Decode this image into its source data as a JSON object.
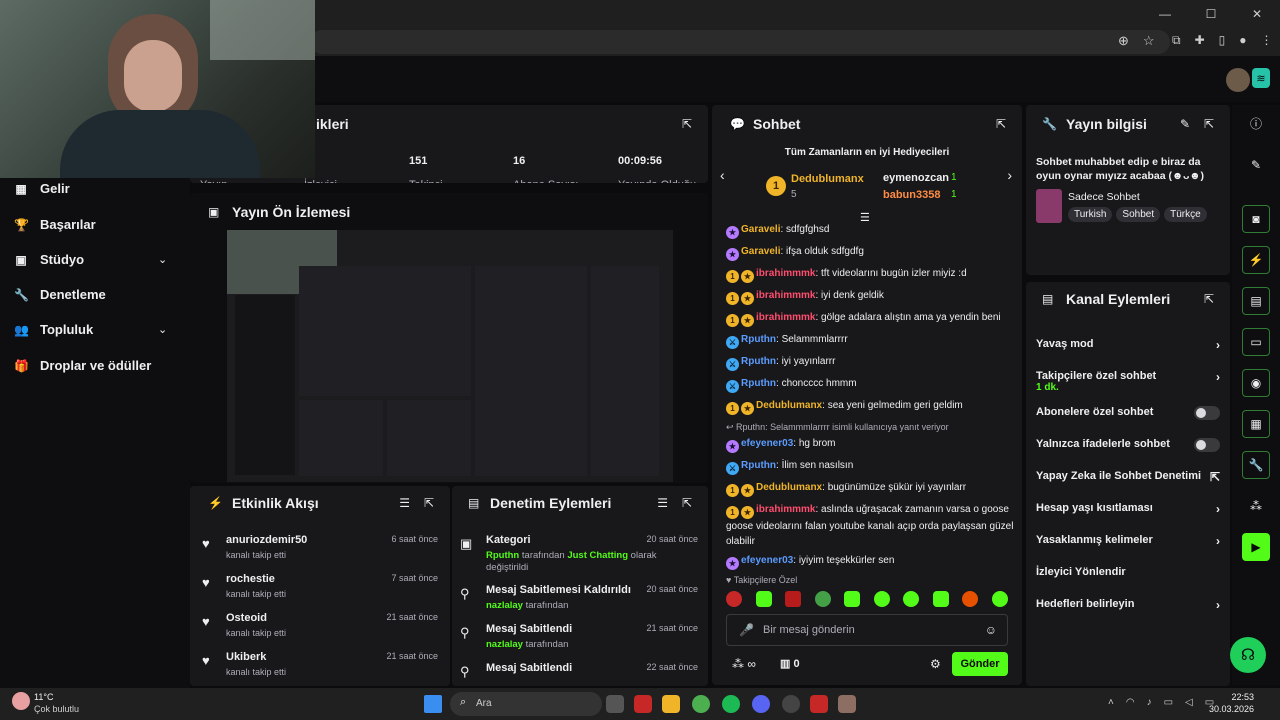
{
  "window": {
    "minimize": "—",
    "maximize": "☐",
    "close": "✕"
  },
  "sidebar": {
    "items": [
      {
        "label": "Gelir",
        "icon": "bar-chart-icon",
        "glyph": "▦",
        "chevron": false
      },
      {
        "label": "Başarılar",
        "icon": "trophy-icon",
        "glyph": "🏆",
        "chevron": false
      },
      {
        "label": "Stüdyo",
        "icon": "studio-icon",
        "glyph": "▣",
        "chevron": true
      },
      {
        "label": "Denetleme",
        "icon": "wrench-icon",
        "glyph": "🔧",
        "chevron": false
      },
      {
        "label": "Topluluk",
        "icon": "community-icon",
        "glyph": "👥",
        "chevron": true
      },
      {
        "label": "Droplar ve ödüller",
        "icon": "gift-icon",
        "glyph": "🎁",
        "chevron": false
      }
    ]
  },
  "stats": {
    "title_fragment": "ikleri",
    "items": [
      {
        "value": "",
        "label": "Yayın"
      },
      {
        "value": "",
        "label": "İzleyici"
      },
      {
        "value": "151",
        "label": "Takipçi"
      },
      {
        "value": "16",
        "label": "Abone Sayısı"
      },
      {
        "value": "00:09:56",
        "label": "Yayında Olduğu"
      }
    ]
  },
  "preview": {
    "title": "Yayın Ön İzlemesi"
  },
  "activity": {
    "title": "Etkinlik Akışı",
    "items": [
      {
        "name": "anuriozdemir50",
        "action": "kanalı takip etti",
        "time": "6 saat önce"
      },
      {
        "name": "rochestie",
        "action": "kanalı takip etti",
        "time": "7 saat önce"
      },
      {
        "name": "Osteoid",
        "action": "kanalı takip etti",
        "time": "21 saat önce"
      },
      {
        "name": "Ukiberk",
        "action": "kanalı takip etti",
        "time": "21 saat önce"
      }
    ]
  },
  "moderation": {
    "title": "Denetim Eylemleri",
    "items": [
      {
        "title": "Kategori",
        "user": "Rputhn",
        "mid": "tarafından",
        "target": "Just Chatting",
        "rest": "olarak değiştirildi",
        "time": "20 saat önce"
      },
      {
        "title": "Mesaj Sabitlemesi Kaldırıldı",
        "user": "nazlalay",
        "mid": "tarafından",
        "target": "",
        "rest": "",
        "time": "20 saat önce"
      },
      {
        "title": "Mesaj Sabitlendi",
        "user": "nazlalay",
        "mid": "tarafından",
        "target": "",
        "rest": "",
        "time": "21 saat önce"
      },
      {
        "title": "Mesaj Sabitlendi",
        "user": "",
        "mid": "",
        "target": "",
        "rest": "",
        "time": "22 saat önce"
      }
    ]
  },
  "chat": {
    "title": "Sohbet",
    "gifters_title": "Tüm Zamanların en iyi Hediyecileri",
    "top_gifter": {
      "name": "Dedublumanx",
      "count": "5",
      "rank": "1"
    },
    "gifters": [
      {
        "name": "eymenozcan",
        "count": "1"
      },
      {
        "name": "babun3358",
        "count": "1"
      }
    ],
    "messages": [
      {
        "badge": "sub",
        "user": "Garaveli",
        "color": "#f0b429",
        "text": "sdfgfghsd"
      },
      {
        "badge": "sub",
        "user": "Garaveli",
        "color": "#f0b429",
        "text": "ifşa olduk sdfgdfg"
      },
      {
        "badge": "gold",
        "user": "ibrahimmmk",
        "color": "#ff4d6d",
        "text": "tft videolarını bugün izler miyiz :d"
      },
      {
        "badge": "gold",
        "user": "ibrahimmmk",
        "color": "#ff4d6d",
        "text": "iyi denk geldik"
      },
      {
        "badge": "gold",
        "user": "ibrahimmmk",
        "color": "#ff4d6d",
        "text": "gölge adalara alıştın ama ya yendin beni"
      },
      {
        "badge": "blue",
        "user": "Rputhn",
        "color": "#5b9cff",
        "text": "Selammmlarrrr"
      },
      {
        "badge": "blue",
        "user": "Rputhn",
        "color": "#5b9cff",
        "text": "iyi yayınlarrr"
      },
      {
        "badge": "blue",
        "user": "Rputhn",
        "color": "#5b9cff",
        "text": "choncccc hmmm"
      },
      {
        "badge": "gold",
        "user": "Dedublumanx",
        "color": "#f0b429",
        "text": "sea yeni gelmedim geri geldim"
      },
      {
        "badge": "reply",
        "user": "",
        "color": "#adadb8",
        "text": "Rputhn: Selammmlarrrr isimli kullanıcıya yanıt veriyor"
      },
      {
        "badge": "sub",
        "user": "efeyener03",
        "color": "#5b9cff",
        "text": "hg brom"
      },
      {
        "badge": "blue",
        "user": "Rputhn",
        "color": "#5b9cff",
        "text": "İlim sen nasılsın"
      },
      {
        "badge": "gold",
        "user": "Dedublumanx",
        "color": "#f0b429",
        "text": "bugünümüze şükür iyi yayınlarr"
      },
      {
        "badge": "gold",
        "user": "ibrahimmmk",
        "color": "#ff4d6d",
        "text": "aslında uğraşacak zamanın varsa o goose goose videolarını falan youtube kanalı açıp orda paylaşsan güzel olabilir"
      },
      {
        "badge": "sub",
        "user": "efeyener03",
        "color": "#5b9cff",
        "text": "iyiyim teşekkürler sen"
      }
    ],
    "followers_only": "Takipçilere Özel",
    "input_placeholder": "Bir mesaj gönderin",
    "infinity": "∞",
    "count": "0",
    "send": "Gönder"
  },
  "info": {
    "title": "Yayın bilgisi",
    "stream_title": "Sohbet muhabbet edip e biraz da oyun oynar mıyızz acabaa (☻ᴗ☻)",
    "category": "Sadece Sohbet",
    "tags": [
      "Turkish",
      "Sohbet",
      "Türkçe"
    ]
  },
  "channel_actions": {
    "title": "Kanal Eylemleri",
    "items": [
      {
        "label": "Yavaş mod",
        "sub": "",
        "control": "chevron"
      },
      {
        "label": "Takipçilere özel sohbet",
        "sub": "1 dk.",
        "control": "chevron"
      },
      {
        "label": "Abonelere özel sohbet",
        "sub": "",
        "control": "toggle"
      },
      {
        "label": "Yalnızca ifadelerle sohbet",
        "sub": "",
        "control": "toggle"
      },
      {
        "label": "Yapay Zeka ile Sohbet Denetimi",
        "sub": "",
        "control": "external"
      },
      {
        "label": "Hesap yaşı kısıtlaması",
        "sub": "",
        "control": "chevron"
      },
      {
        "label": "Yasaklanmış kelimeler",
        "sub": "",
        "control": "chevron"
      },
      {
        "label": "İzleyici Yönlendir",
        "sub": "",
        "control": "none"
      },
      {
        "label": "Hedefleri belirleyin",
        "sub": "",
        "control": "chevron"
      }
    ]
  },
  "taskbar": {
    "temp": "11°C",
    "weather": "Çok bulutlu",
    "search": "Ara",
    "time": "22:53",
    "date": "30.03.2026"
  },
  "colors": {
    "accent": "#53fc18",
    "panel": "#18181b",
    "bg": "#0e0e10"
  }
}
